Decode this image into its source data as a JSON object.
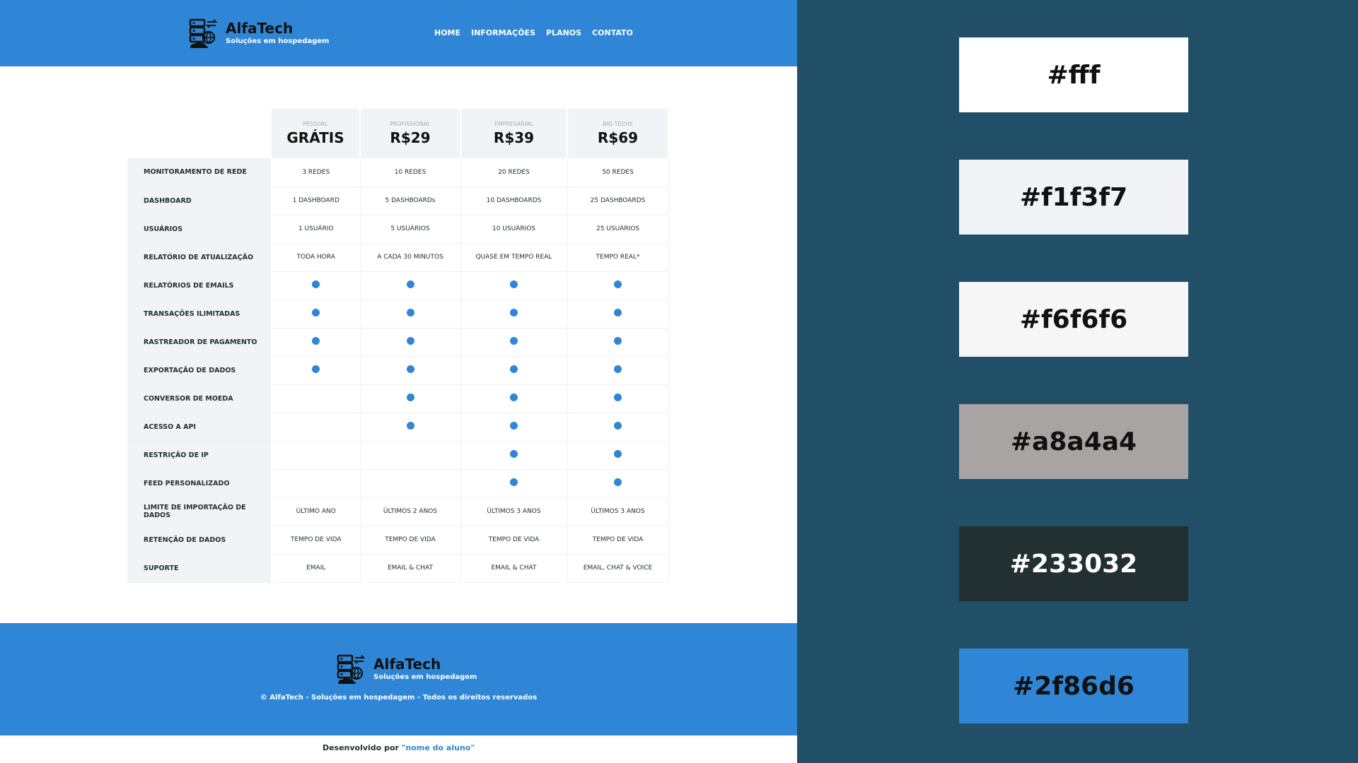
{
  "brand": {
    "name": "AlfaTech",
    "tagline": "Soluções em hospedagem"
  },
  "nav": [
    "HOME",
    "INFORMAÇÕES",
    "PLANOS",
    "CONTATO"
  ],
  "plans": [
    {
      "tier": "PESSOAL",
      "price": "GRÁTIS"
    },
    {
      "tier": "PROFISSIONAL",
      "price": "R$29"
    },
    {
      "tier": "EMPRESARIAL",
      "price": "R$39"
    },
    {
      "tier": "BIG TECHS",
      "price": "R$69"
    }
  ],
  "rows": [
    {
      "label": "MONITORAMENTO DE REDE",
      "cells": [
        "3 REDES",
        "10 REDES",
        "20 REDES",
        "50 REDES"
      ]
    },
    {
      "label": "DASHBOARD",
      "cells": [
        "1 DASHBOARD",
        "5 DASHBOARDs",
        "10 DASHBOARDS",
        "25 DASHBOARDS"
      ]
    },
    {
      "label": "USUÁRIOS",
      "cells": [
        "1 USUÁRIO",
        "5 USUÁRIOS",
        "10 USUÁRIOS",
        "25 USUÁRIOS"
      ]
    },
    {
      "label": "RELATÓRIO DE ATUALIZAÇÃO",
      "cells": [
        "TODA HORA",
        "A CADA 30 MINUTOS",
        "QUASE EM TEMPO REAL",
        "TEMPO REAL*"
      ]
    },
    {
      "label": "RELATÓRIOS DE EMAILS",
      "cells": [
        true,
        true,
        true,
        true
      ]
    },
    {
      "label": "TRANSAÇÕES ILIMITADAS",
      "cells": [
        true,
        true,
        true,
        true
      ]
    },
    {
      "label": "RASTREADOR DE PAGAMENTO",
      "cells": [
        true,
        true,
        true,
        true
      ]
    },
    {
      "label": "EXPORTAÇÃO DE DADOS",
      "cells": [
        true,
        true,
        true,
        true
      ]
    },
    {
      "label": "CONVERSOR DE MOEDA",
      "cells": [
        false,
        true,
        true,
        true
      ]
    },
    {
      "label": "ACESSO A API",
      "cells": [
        false,
        true,
        true,
        true
      ]
    },
    {
      "label": "RESTRIÇÃO DE IP",
      "cells": [
        false,
        false,
        true,
        true
      ]
    },
    {
      "label": "FEED PERSONALIZADO",
      "cells": [
        false,
        false,
        true,
        true
      ]
    },
    {
      "label": "LIMITE DE IMPORTAÇÃO DE DADOS",
      "cells": [
        "ÚLTIMO ANO",
        "ÚLTIMOS 2 ANOS",
        "ÚLTIMOS 3 ANOS",
        "ÚLTIMOS 3 ANOS"
      ]
    },
    {
      "label": "RETENÇÃO DE DADOS",
      "cells": [
        "TEMPO DE VIDA",
        "TEMPO DE VIDA",
        "TEMPO DE VIDA",
        "TEMPO DE VIDA"
      ]
    },
    {
      "label": "SUPORTE",
      "cells": [
        "EMAIL",
        "EMAIL & CHAT",
        "EMAIL & CHAT",
        "EMAIL, CHAT & VOICE"
      ]
    }
  ],
  "footer": {
    "copyright": "© AlfaTech - Soluções em hospedagem - Todos os direitos reservados",
    "dev_prefix": "Desenvolvido por",
    "dev_name": "\"nome do aluno\""
  },
  "palette": [
    {
      "label": "#fff",
      "bg": "#ffffff",
      "fg": "#111111"
    },
    {
      "label": "#f1f3f7",
      "bg": "#f1f3f7",
      "fg": "#111111"
    },
    {
      "label": "#f6f6f6",
      "bg": "#f6f6f6",
      "fg": "#111111"
    },
    {
      "label": "#a8a4a4",
      "bg": "#a8a4a4",
      "fg": "#111111"
    },
    {
      "label": "#233032",
      "bg": "#233032",
      "fg": "#ffffff"
    },
    {
      "label": "#2f86d6",
      "bg": "#2f86d6",
      "fg": "#111111"
    }
  ],
  "colors": {
    "page_bg": "#214f68",
    "accent": "#2f86d6",
    "dark": "#233032"
  }
}
